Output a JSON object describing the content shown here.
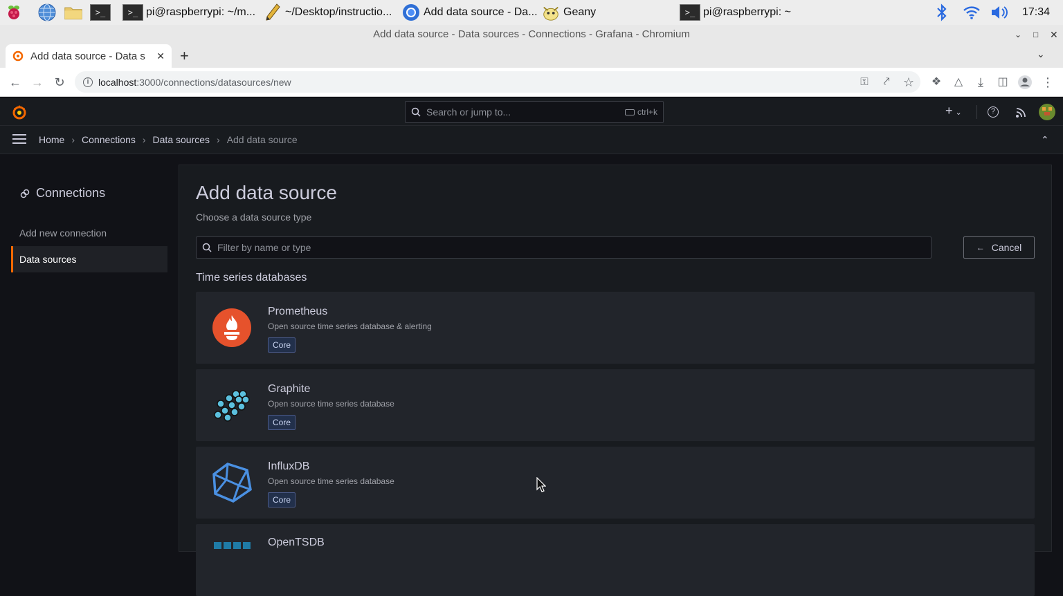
{
  "taskbar": {
    "items": [
      {
        "label": "pi@raspberrypi: ~/m..."
      },
      {
        "label": "~/Desktop/instructio..."
      },
      {
        "label": "Add data source - Da..."
      },
      {
        "label": "Geany"
      },
      {
        "label": "pi@raspberrypi: ~"
      }
    ],
    "clock": "17:34",
    "terminal_glyph": ">_"
  },
  "window": {
    "title": "Add data source - Data sources - Connections - Grafana - Chromium"
  },
  "browser": {
    "tab_title": "Add data source - Data s",
    "url_host": "localhost",
    "url_rest": ":3000/connections/datasources/new"
  },
  "grafana": {
    "search_placeholder": "Search or jump to...",
    "search_shortcut": "ctrl+k",
    "breadcrumbs": [
      "Home",
      "Connections",
      "Data sources",
      "Add data source"
    ],
    "sidebar": {
      "title": "Connections",
      "items": [
        {
          "label": "Add new connection"
        },
        {
          "label": "Data sources"
        }
      ]
    },
    "page": {
      "title": "Add data source",
      "subtitle": "Choose a data source type",
      "filter_placeholder": "Filter by name or type",
      "cancel_label": "Cancel",
      "section_title": "Time series databases",
      "datasources": [
        {
          "name": "Prometheus",
          "description": "Open source time series database & alerting",
          "badge": "Core",
          "icon": "prometheus-logo"
        },
        {
          "name": "Graphite",
          "description": "Open source time series database",
          "badge": "Core",
          "icon": "graphite-logo"
        },
        {
          "name": "InfluxDB",
          "description": "Open source time series database",
          "badge": "Core",
          "icon": "influxdb-logo"
        },
        {
          "name": "OpenTSDB",
          "icon": "opentsdb-logo"
        }
      ]
    }
  },
  "colors": {
    "accent": "#f46800",
    "prometheus": "#e6522c",
    "influx": "#4a90e2"
  }
}
